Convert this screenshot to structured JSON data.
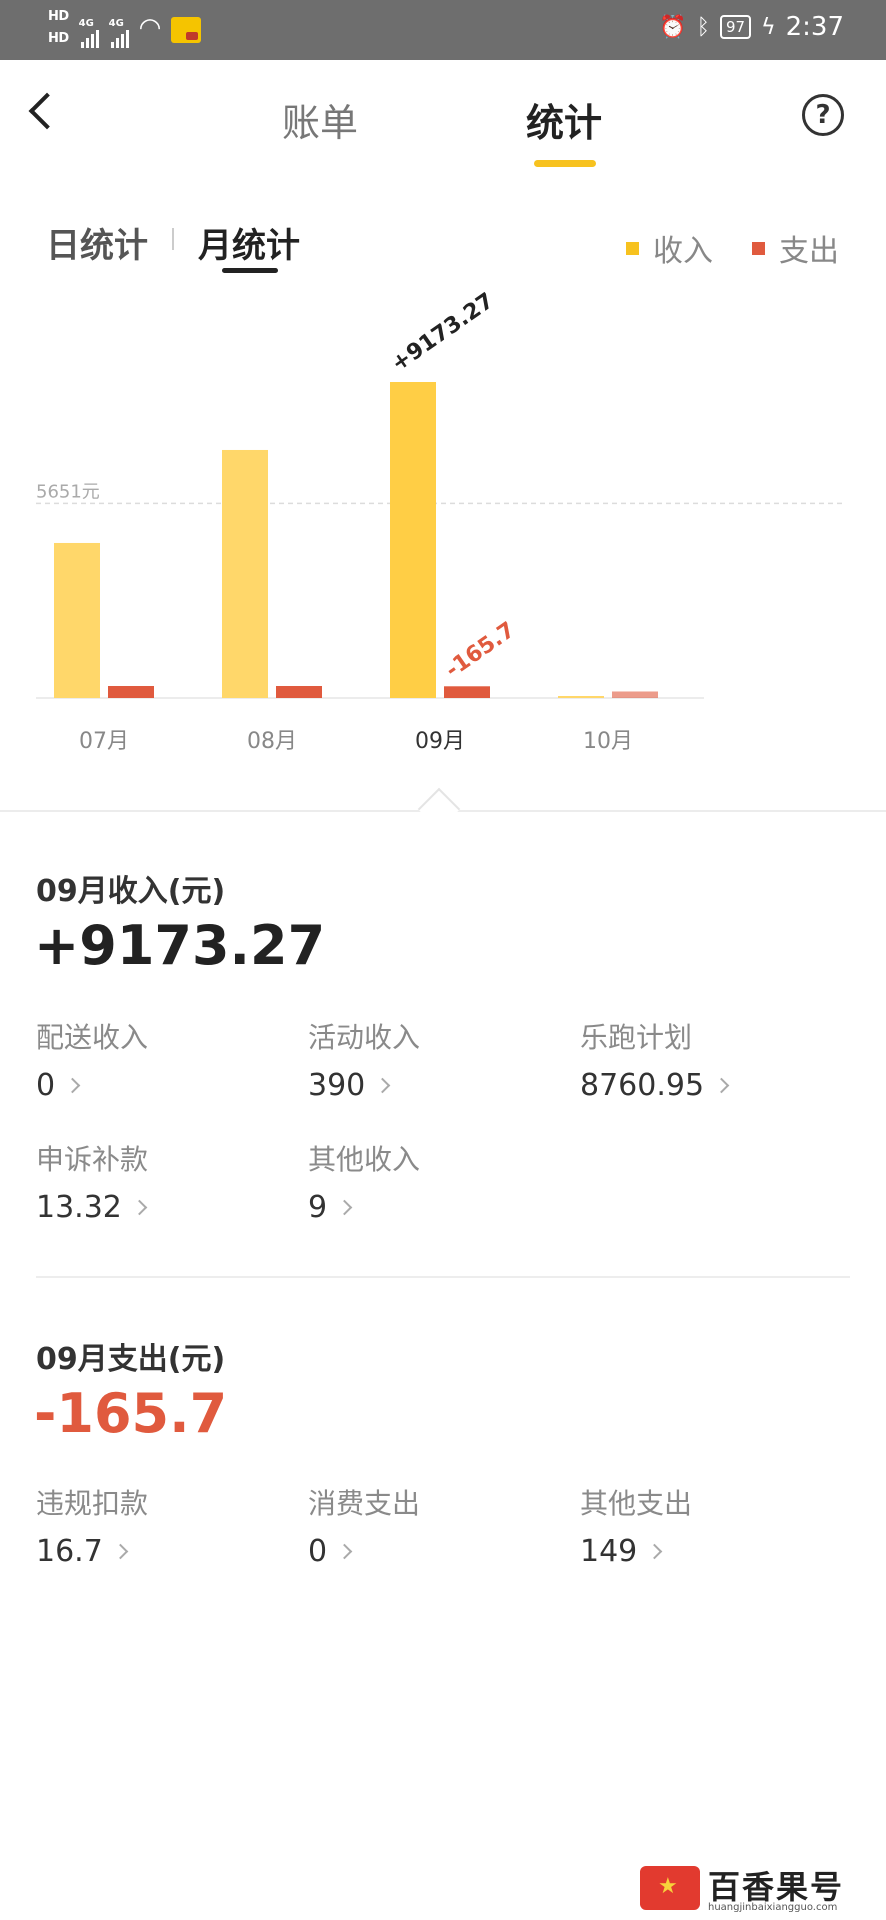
{
  "status_bar": {
    "hd1": "HD",
    "hd2": "HD",
    "net1": "4G",
    "net2": "4G",
    "battery": "97",
    "time": "2:37"
  },
  "nav": {
    "tab_bill": "账单",
    "tab_stats": "统计",
    "help": "?"
  },
  "subtabs": {
    "day": "日统计",
    "month": "月统计"
  },
  "legend": {
    "income": "收入",
    "expense": "支出"
  },
  "colors": {
    "income": "#ffd76a",
    "income_active": "#ffce45",
    "expense": "#e05a3e",
    "accent": "#f7c21f"
  },
  "chart_data": {
    "type": "bar",
    "categories": [
      "07月",
      "08月",
      "09月",
      "10月"
    ],
    "series": [
      {
        "name": "收入",
        "values": [
          4500,
          7200,
          9173.27,
          30
        ]
      },
      {
        "name": "支出",
        "values": [
          230,
          180,
          165.7,
          15
        ]
      }
    ],
    "reference_label": "5651元",
    "reference_value": 5651,
    "selected_category": "09月",
    "selected_income_label": "+9173.27",
    "selected_expense_label": "-165.7",
    "ylim": [
      0,
      9173.27
    ]
  },
  "income": {
    "title": "09月收入(元)",
    "total": "+9173.27",
    "items": [
      {
        "label": "配送收入",
        "value": "0"
      },
      {
        "label": "活动收入",
        "value": "390"
      },
      {
        "label": "乐跑计划",
        "value": "8760.95"
      },
      {
        "label": "申诉补款",
        "value": "13.32"
      },
      {
        "label": "其他收入",
        "value": "9"
      }
    ]
  },
  "expense": {
    "title": "09月支出(元)",
    "total": "-165.7",
    "items": [
      {
        "label": "违规扣款",
        "value": "16.7"
      },
      {
        "label": "消费支出",
        "value": "0"
      },
      {
        "label": "其他支出",
        "value": "149"
      }
    ]
  },
  "watermark": {
    "text": "百香果号",
    "url": "huangjinbaixiangguo.com"
  }
}
